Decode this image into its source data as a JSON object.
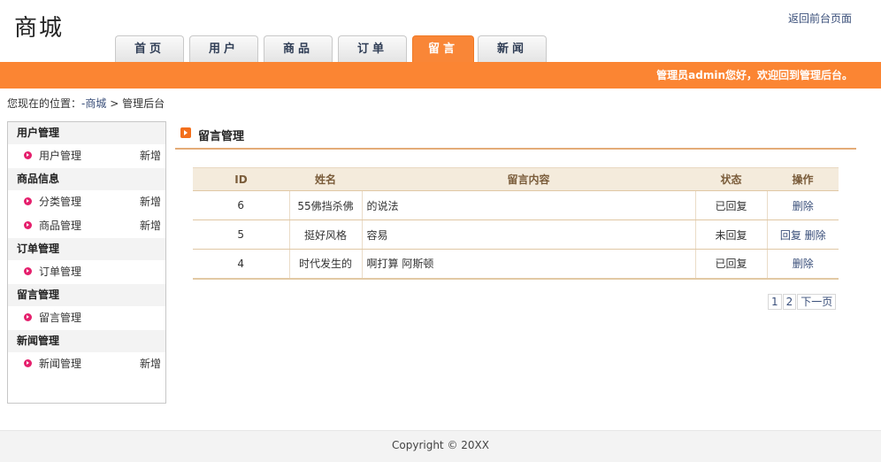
{
  "header": {
    "logo_text": "商城",
    "top_link": "返回前台页面",
    "nav": [
      {
        "label": "首页"
      },
      {
        "label": "用户"
      },
      {
        "label": "商品"
      },
      {
        "label": "订单"
      },
      {
        "label": "留言",
        "active": true
      },
      {
        "label": "新闻"
      }
    ],
    "welcome": "管理员admin您好，欢迎回到管理后台。"
  },
  "breadcrumb": {
    "prefix": "您现在的位置：",
    "home": "-商城",
    "sep": ">",
    "current": "管理后台"
  },
  "sidebar": {
    "groups": [
      {
        "title": "用户管理",
        "items": [
          {
            "label": "用户管理",
            "add": "新增"
          }
        ]
      },
      {
        "title": "商品信息",
        "items": [
          {
            "label": "分类管理",
            "add": "新增"
          },
          {
            "label": "商品管理",
            "add": "新增"
          }
        ]
      },
      {
        "title": "订单管理",
        "items": [
          {
            "label": "订单管理"
          }
        ]
      },
      {
        "title": "留言管理",
        "items": [
          {
            "label": "留言管理"
          }
        ]
      },
      {
        "title": "新闻管理",
        "items": [
          {
            "label": "新闻管理",
            "add": "新增"
          }
        ]
      }
    ]
  },
  "content": {
    "title": "留言管理",
    "columns": [
      "ID",
      "姓名",
      "留言内容",
      "状态",
      "操作"
    ],
    "rows": [
      {
        "id": "6",
        "name": "55佛挡杀佛",
        "content": "的说法",
        "status": "已回复",
        "reply": "",
        "delete": "删除"
      },
      {
        "id": "5",
        "name": "挺好风格",
        "content": "容易",
        "status": "未回复",
        "reply": "回复",
        "delete": "删除"
      },
      {
        "id": "4",
        "name": "时代发生的",
        "content": "啊打算 阿斯顿",
        "status": "已回复",
        "reply": "",
        "delete": "删除"
      }
    ],
    "pager": {
      "page1": "1",
      "page2": "2",
      "next": "下一页"
    }
  },
  "footer": {
    "copyright": "Copyright © 20XX"
  },
  "colors": {
    "accent": "#fb8533",
    "bullet": "#e5206d",
    "link": "#3a4f7a"
  }
}
